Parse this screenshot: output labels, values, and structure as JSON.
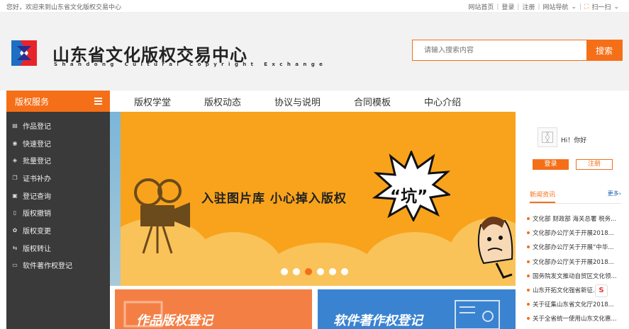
{
  "topbar": {
    "welcome": "您好，欢迎来到山东省文化版权交易中心",
    "links": [
      "网站首页",
      "登录",
      "注册",
      "网站导航"
    ],
    "scan": "扫一扫"
  },
  "brand": {
    "name_cn": "山东省文化版权交易中心",
    "name_en": "Shandong Cultural Copyright Exchange"
  },
  "search": {
    "placeholder": "请输入搜索内容",
    "button": "搜索"
  },
  "sidebar": {
    "title": "版权服务",
    "items": [
      {
        "label": "作品登记",
        "icon": "document-icon"
      },
      {
        "label": "快速登记",
        "icon": "bolt-icon"
      },
      {
        "label": "批量登记",
        "icon": "layers-icon"
      },
      {
        "label": "证书补办",
        "icon": "certificate-icon"
      },
      {
        "label": "登记查询",
        "icon": "query-icon"
      },
      {
        "label": "版权撤销",
        "icon": "revoke-icon"
      },
      {
        "label": "版权变更",
        "icon": "change-icon"
      },
      {
        "label": "版权转让",
        "icon": "transfer-icon"
      },
      {
        "label": "软件著作权登记",
        "icon": "software-icon"
      }
    ]
  },
  "nav": [
    "版权学堂",
    "版权动态",
    "协议与说明",
    "合同模板",
    "中心介绍"
  ],
  "banner": {
    "headline": "入驻图片库 小心掉入版权",
    "keyword": "“坑”",
    "slide_count": 6,
    "active_slide": 3
  },
  "cards": [
    {
      "title": "作品版权登记"
    },
    {
      "title": "软件著作权登记"
    }
  ],
  "user": {
    "greeting": "Hi！你好",
    "login": "登录",
    "register": "注册"
  },
  "news": {
    "tab": "新闻资讯",
    "more": "更多›",
    "items": [
      "文化部 财政部 海关总署 税务...",
      "文化部办公厅关于开展2018...",
      "文化部办公厅关于开展“中华...",
      "文化部办公厅关于开展2018...",
      "国务院发文推动自贸区文化领...",
      "山东开拓文化强省新征...",
      "关于征集山东省文化厅2018...",
      "关于全省统一使用山东文化惠..."
    ]
  },
  "colors": {
    "accent": "#f56f18",
    "sidebar": "#3a3a3a",
    "banner": "#f8a31b"
  }
}
